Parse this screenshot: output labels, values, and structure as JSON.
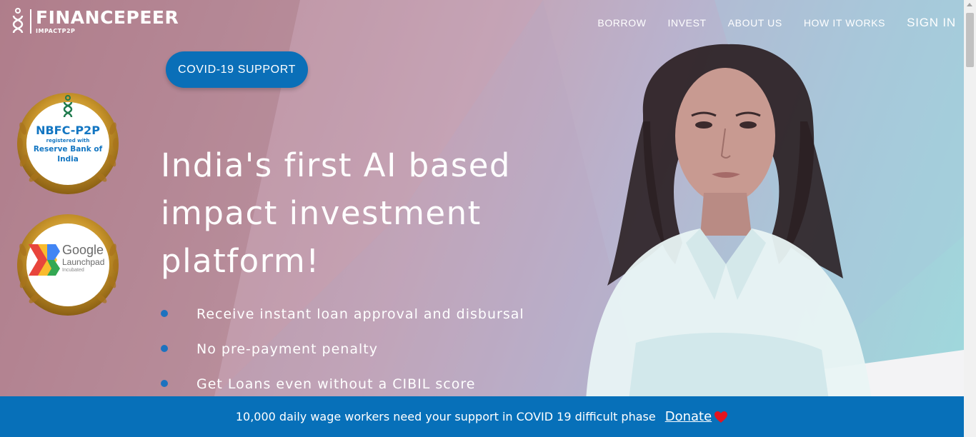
{
  "brand": {
    "name": "FINANCEPEER",
    "tagline": "IMPACTP2P"
  },
  "nav": {
    "items": [
      "BORROW",
      "INVEST",
      "ABOUT US",
      "HOW IT WORKS"
    ],
    "signin": "SIGN IN"
  },
  "covid_button": "COVID-19 SUPPORT",
  "badges": {
    "nbfc": {
      "title": "NBFC-P2P",
      "registered": "registered with",
      "rbi_line1": "Reserve Bank of",
      "rbi_line2": "India"
    },
    "google": {
      "name": "Google",
      "launchpad": "Launchpad",
      "incubated": "Incubated"
    }
  },
  "hero": {
    "headline_line1": "India's first AI based",
    "headline_line2": "impact investment",
    "headline_line3": "platform!",
    "bullets": [
      "Receive instant loan approval and disbursal",
      "No pre-payment penalty",
      "Get Loans even without a CIBIL score"
    ]
  },
  "banner": {
    "text": "10,000 daily wage workers need your support in COVID 19 difficult phase",
    "link": "Donate"
  },
  "colors": {
    "primary": "#0a6fb8",
    "banner": "#0770b9",
    "heart": "#e4141f",
    "nbfc_text": "#1376c2"
  },
  "icons": [
    "financepeer-logo-icon",
    "laurel-wreath-icon",
    "google-launchpad-chevron-icon",
    "heart-icon"
  ]
}
